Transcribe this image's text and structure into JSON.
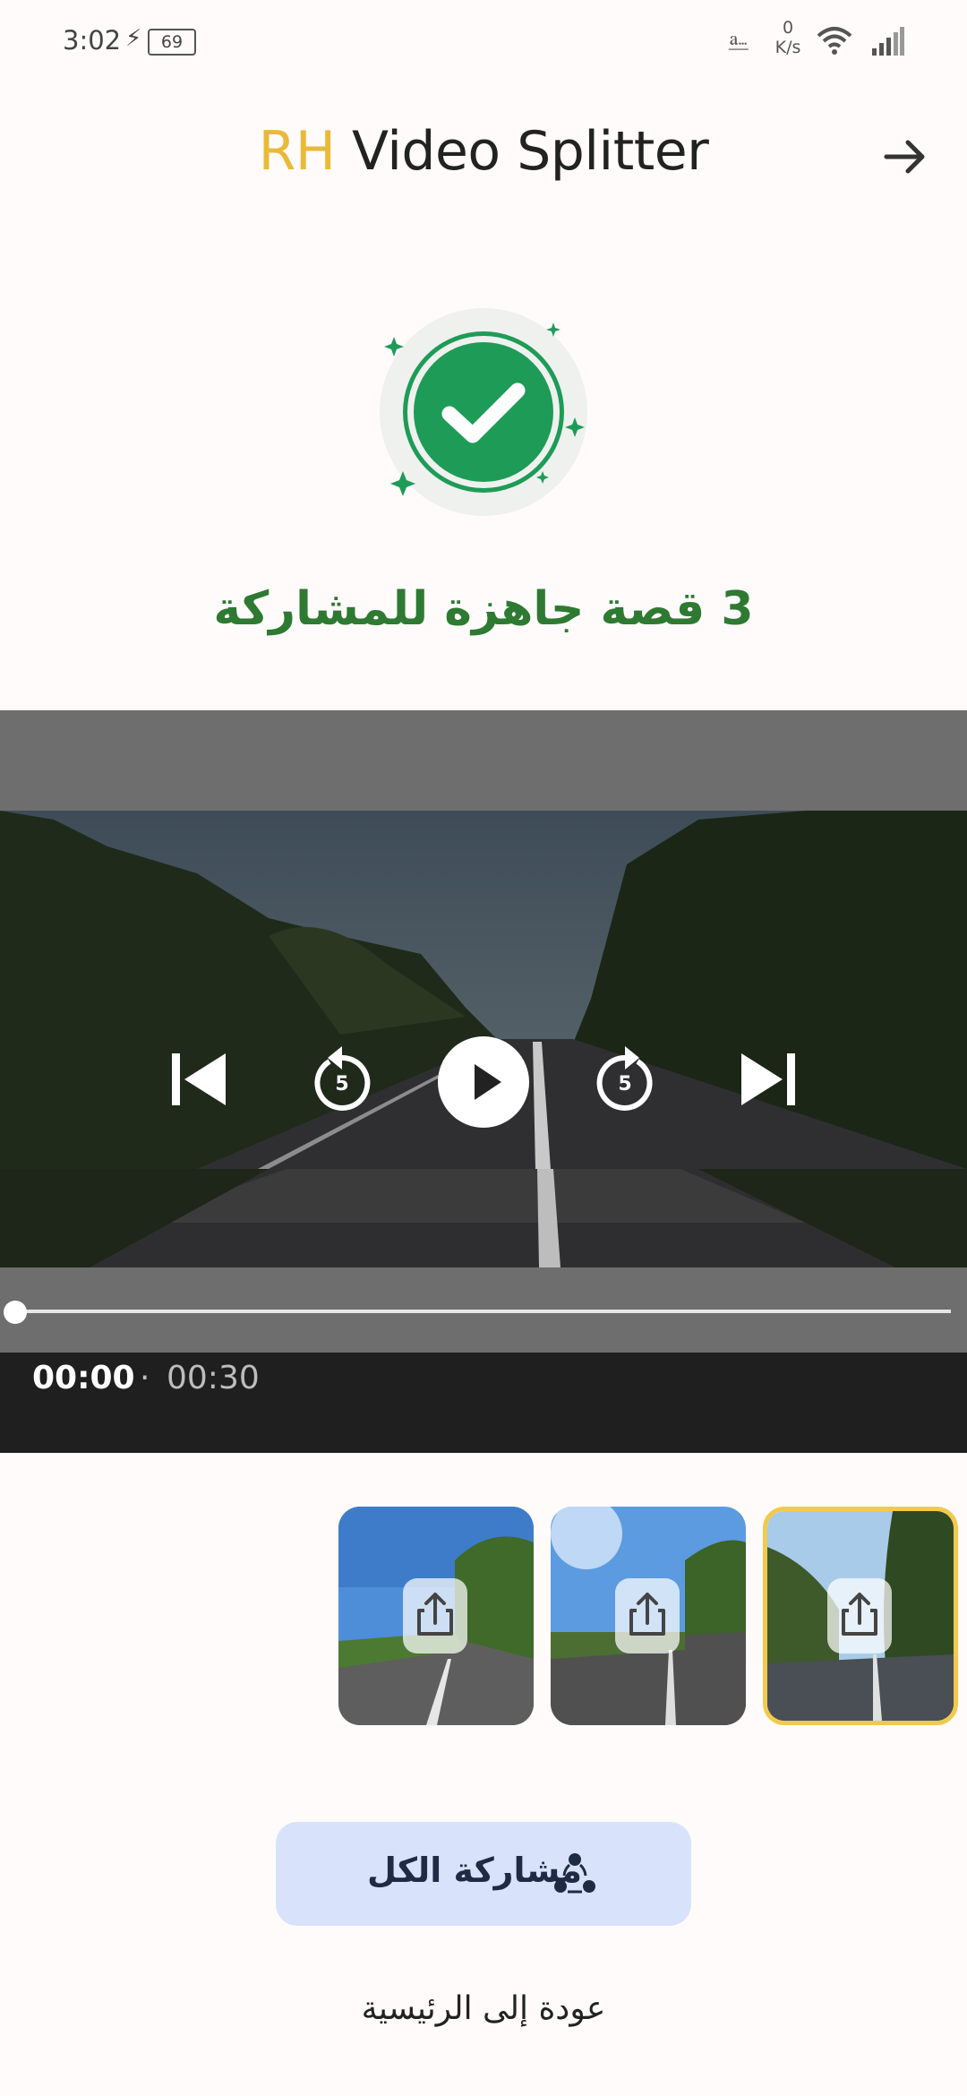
{
  "status_bar": {
    "time": "3:02",
    "battery": "69",
    "net_speed_value": "0",
    "net_speed_unit": "K/s"
  },
  "header": {
    "title_prefix": "RH",
    "title_rest": " Video Splitter"
  },
  "success": {
    "message": "3 قصة جاهزة للمشاركة"
  },
  "player": {
    "current_time": "00:00",
    "separator": "·",
    "duration": "00:30",
    "progress": 0,
    "skip_seconds": "5"
  },
  "clips": [
    {
      "selected": false
    },
    {
      "selected": false
    },
    {
      "selected": true
    }
  ],
  "actions": {
    "share_all_label": "مشاركة الكل",
    "back_home_label": "عودة إلى الرئيسية"
  },
  "colors": {
    "accent_yellow": "#E9B93A",
    "success_green": "#1E9C57",
    "message_green": "#2E7A32",
    "share_button_bg": "#D8E3FB"
  }
}
